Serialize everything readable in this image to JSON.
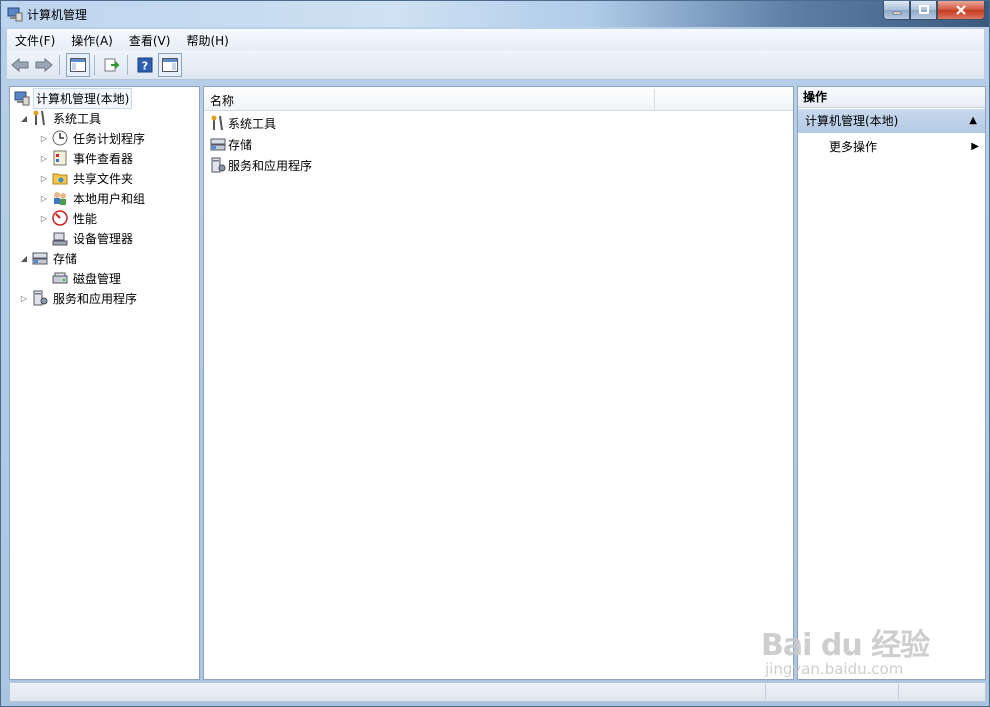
{
  "window": {
    "title": "计算机管理"
  },
  "menu": [
    {
      "label": "文件(F)"
    },
    {
      "label": "操作(A)"
    },
    {
      "label": "查看(V)"
    },
    {
      "label": "帮助(H)"
    }
  ],
  "toolbar": {
    "back": "back-arrow-icon",
    "forward": "forward-arrow-icon",
    "show_hide_tree": "console-tree-icon",
    "export": "export-list-icon",
    "help": "help-icon",
    "show_hide_action": "action-pane-icon"
  },
  "tree": {
    "root": "计算机管理(本地)",
    "items": [
      {
        "label": "系统工具",
        "level": 1,
        "expanded": true
      },
      {
        "label": "任务计划程序",
        "level": 2,
        "expander": true
      },
      {
        "label": "事件查看器",
        "level": 2,
        "expander": true
      },
      {
        "label": "共享文件夹",
        "level": 2,
        "expander": true
      },
      {
        "label": "本地用户和组",
        "level": 2,
        "expander": true
      },
      {
        "label": "性能",
        "level": 2,
        "expander": true
      },
      {
        "label": "设备管理器",
        "level": 2,
        "expander": false
      },
      {
        "label": "存储",
        "level": 1,
        "expanded": true
      },
      {
        "label": "磁盘管理",
        "level": 2,
        "expander": false
      },
      {
        "label": "服务和应用程序",
        "level": 1,
        "expander": true
      }
    ]
  },
  "list": {
    "column": "名称",
    "rows": [
      "系统工具",
      "存储",
      "服务和应用程序"
    ]
  },
  "actions": {
    "header": "操作",
    "section": "计算机管理(本地)",
    "item": "更多操作"
  },
  "watermark": {
    "logo": "Bai du 经验",
    "url": "jingyan.baidu.com"
  },
  "colors": {
    "selection": "#c6d9ee",
    "action_section": "#b3c9e3"
  }
}
